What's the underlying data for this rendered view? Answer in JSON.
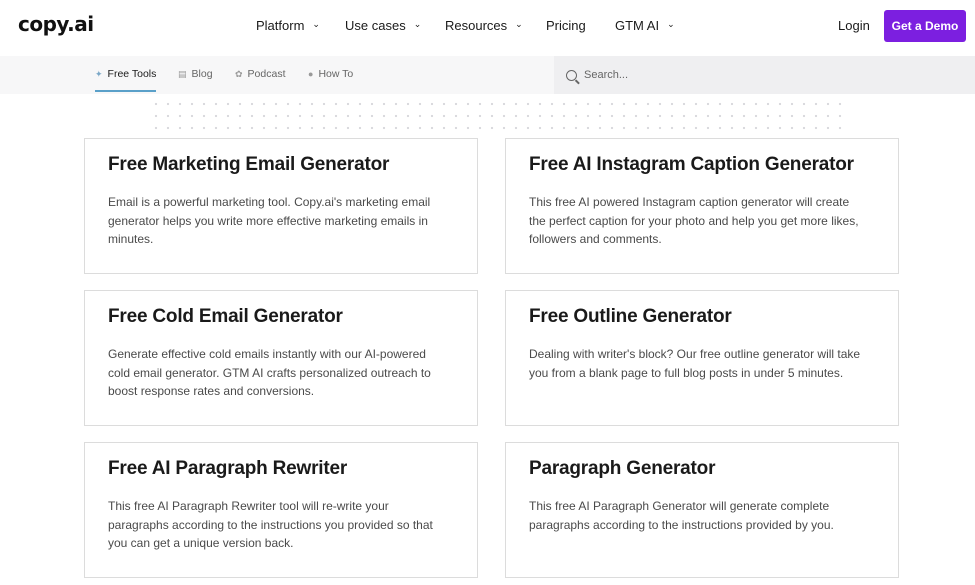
{
  "brand": {
    "logo_text": "copy",
    "logo_dot": ".",
    "logo_suffix": "ai"
  },
  "nav": {
    "platform": "Platform",
    "use_cases": "Use cases",
    "resources": "Resources",
    "pricing": "Pricing",
    "gtm_ai": "GTM AI",
    "login": "Login",
    "demo": "Get a Demo"
  },
  "subnav": {
    "tabs": [
      {
        "label": "Free Tools",
        "icon": "tools-icon",
        "active": true
      },
      {
        "label": "Blog",
        "icon": "blog-icon",
        "active": false
      },
      {
        "label": "Podcast",
        "icon": "podcast-icon",
        "active": false
      },
      {
        "label": "How To",
        "icon": "info-icon",
        "active": false
      }
    ],
    "search_placeholder": "Search..."
  },
  "cards": [
    {
      "title": "Free Marketing Email Generator",
      "description": "Email is a powerful marketing tool. Copy.ai's marketing email generator helps you write more effective marketing emails in minutes."
    },
    {
      "title": "Free AI Instagram Caption Generator",
      "description": "This free AI powered Instagram caption generator will create the perfect caption for your photo and help you get more likes, followers and comments."
    },
    {
      "title": "Free Cold Email Generator",
      "description": "Generate effective cold emails instantly with our AI-powered cold email generator. GTM AI crafts personalized outreach to boost response rates and conversions."
    },
    {
      "title": "Free Outline Generator",
      "description": "Dealing with writer's block? Our free outline generator will take you from a blank page to full blog posts in under 5 minutes."
    },
    {
      "title": "Free AI Paragraph Rewriter",
      "description": "This free AI Paragraph Rewriter tool will re-write your paragraphs according to the instructions you provided so that you can get a unique version back."
    },
    {
      "title": "Paragraph Generator",
      "description": "This free AI Paragraph Generator will generate complete paragraphs according to the instructions provided by you."
    }
  ],
  "colors": {
    "accent": "#7c1fe0",
    "tab_underline": "#5aa0c9"
  }
}
